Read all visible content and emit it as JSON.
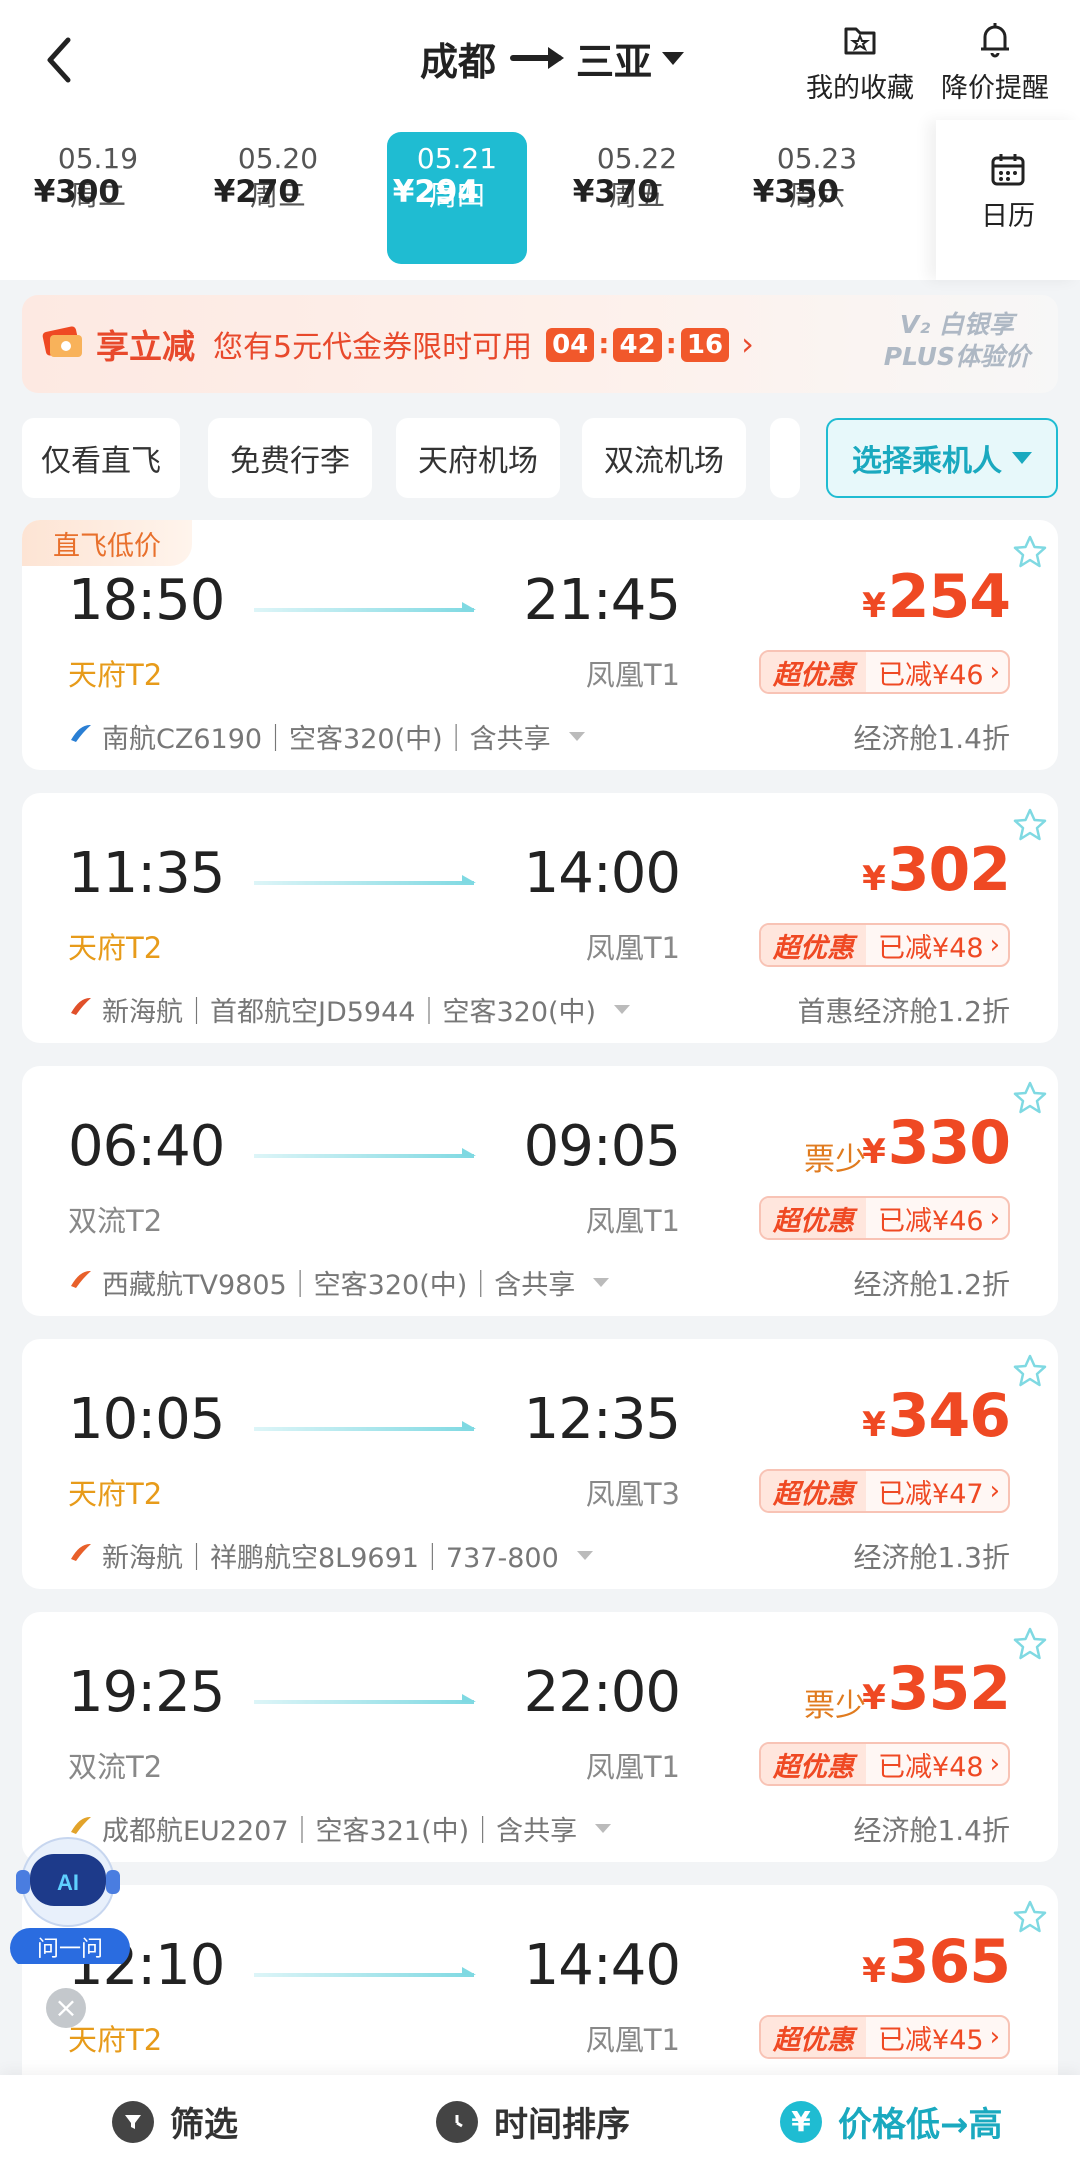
{
  "header": {
    "origin": "成都",
    "destination": "三亚",
    "favorites_label": "我的收藏",
    "price_alert_label": "降价提醒"
  },
  "dates": [
    {
      "date": "05.19",
      "weekday": "周二",
      "price": "¥300",
      "selected": false
    },
    {
      "date": "05.20",
      "weekday": "周三",
      "price": "¥270",
      "selected": false
    },
    {
      "date": "05.21",
      "weekday": "周四",
      "price": "¥294",
      "selected": true
    },
    {
      "date": "05.22",
      "weekday": "周五",
      "price": "¥370",
      "selected": false
    },
    {
      "date": "05.23",
      "weekday": "周六",
      "price": "¥350",
      "selected": false
    }
  ],
  "calendar_label": "日历",
  "promo": {
    "tag": "享立减",
    "message": "您有5元代金券限时可用",
    "countdown": [
      "04",
      "42",
      "16"
    ],
    "plus_line1": "V₂ 白银享",
    "plus_line2": "PLUS体验价"
  },
  "filters": [
    "仅看直飞",
    "免费行李",
    "天府机场",
    "双流机场"
  ],
  "passenger_selector": "选择乘机人",
  "flights": [
    {
      "badge": "直飞低价",
      "dep_time": "18:50",
      "arr_time": "21:45",
      "dep_airport": "天府T2",
      "arr_airport": "凤凰T1",
      "airline_info": "南航CZ6190｜空客320(中)｜含共享",
      "price_currency": "¥",
      "price": "254",
      "few_tickets": "",
      "deal_tag": "超优惠",
      "deal_saving": "已减¥46",
      "cabin": "经济舱1.4折",
      "logo_color": "#2a7fd4"
    },
    {
      "badge": "",
      "dep_time": "11:35",
      "arr_time": "14:00",
      "dep_airport": "天府T2",
      "arr_airport": "凤凰T1",
      "airline_info": "新海航｜首都航空JD5944｜空客320(中)",
      "price_currency": "¥",
      "price": "302",
      "few_tickets": "",
      "deal_tag": "超优惠",
      "deal_saving": "已减¥48",
      "cabin": "首惠经济舱1.2折",
      "logo_color": "#e0502a"
    },
    {
      "badge": "",
      "dep_time": "06:40",
      "arr_time": "09:05",
      "dep_airport": "双流T2",
      "arr_airport": "凤凰T1",
      "airline_info": "西藏航TV9805｜空客320(中)｜含共享",
      "price_currency": "¥",
      "price": "330",
      "few_tickets": "票少",
      "deal_tag": "超优惠",
      "deal_saving": "已减¥46",
      "cabin": "经济舱1.2折",
      "logo_color": "#e8602a"
    },
    {
      "badge": "",
      "dep_time": "10:05",
      "arr_time": "12:35",
      "dep_airport": "天府T2",
      "arr_airport": "凤凰T3",
      "airline_info": "新海航｜祥鹏航空8L9691｜737-800",
      "price_currency": "¥",
      "price": "346",
      "few_tickets": "",
      "deal_tag": "超优惠",
      "deal_saving": "已减¥47",
      "cabin": "经济舱1.3折",
      "logo_color": "#e8602a"
    },
    {
      "badge": "",
      "dep_time": "19:25",
      "arr_time": "22:00",
      "dep_airport": "双流T2",
      "arr_airport": "凤凰T1",
      "airline_info": "成都航EU2207｜空客321(中)｜含共享",
      "price_currency": "¥",
      "price": "352",
      "few_tickets": "票少",
      "deal_tag": "超优惠",
      "deal_saving": "已减¥48",
      "cabin": "经济舱1.4折",
      "logo_color": "#e2a32a"
    },
    {
      "badge": "",
      "dep_time": "12:10",
      "arr_time": "14:40",
      "dep_airport": "天府T2",
      "arr_airport": "凤凰T1",
      "airline_info": "",
      "price_currency": "¥",
      "price": "365",
      "few_tickets": "",
      "deal_tag": "超优惠",
      "deal_saving": "已减¥45",
      "cabin": "",
      "logo_color": "#e2a32a"
    }
  ],
  "ai_assistant": {
    "badge": "AI",
    "label": "问一问"
  },
  "bottom_bar": {
    "filter": "筛选",
    "time_sort": "时间排序",
    "price_sort": "价格低→高"
  },
  "colors": {
    "accent": "#1fbcd2",
    "price_red": "#ef4923",
    "tianfu_orange": "#e79b1a"
  }
}
